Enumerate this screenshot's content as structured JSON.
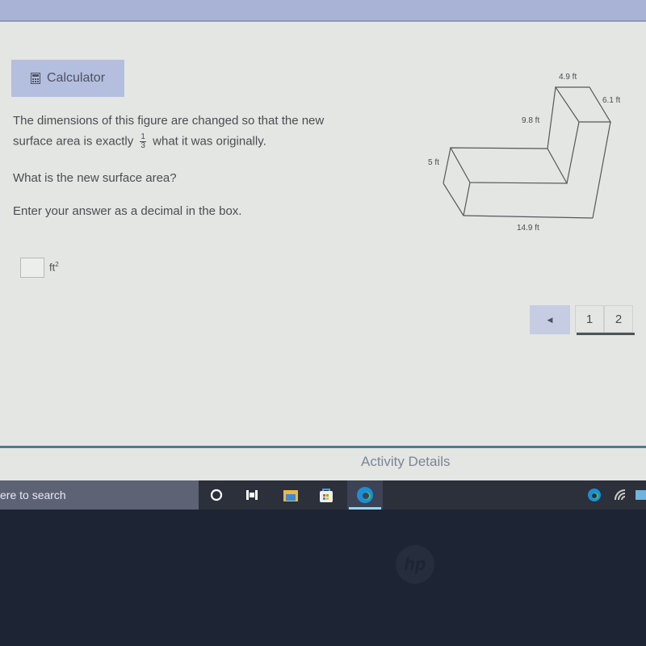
{
  "calculator": {
    "label": "Calculator",
    "icon": "calculator-icon"
  },
  "question": {
    "line1": "The dimensions of this figure are changed so that the new",
    "line2_pre": "surface area is exactly",
    "fraction": {
      "numerator": "1",
      "denominator": "3"
    },
    "line2_post": "what it was originally.",
    "prompt": "What is the new surface area?",
    "instruction": "Enter your answer as a decimal in the box."
  },
  "answer": {
    "value": "",
    "placeholder": "",
    "unit": "ft",
    "unit_exponent": "2"
  },
  "figure": {
    "labels": {
      "top_width": "4.9 ft",
      "top_depth": "6.1 ft",
      "vertical_height": "9.8 ft",
      "left_height": "5 ft",
      "bottom_length": "14.9 ft"
    }
  },
  "pagination": {
    "prev_icon": "◀",
    "pages": [
      "1",
      "2"
    ],
    "current": "1"
  },
  "footer": {
    "activity_details": "Activity Details"
  },
  "taskbar": {
    "search_text": "ere to search",
    "icons": [
      "cortana-icon",
      "task-view-icon",
      "file-explorer-icon",
      "store-icon",
      "edge-icon"
    ],
    "tray_icons": [
      "edge-tray-icon",
      "wifi-icon",
      "news-icon"
    ]
  },
  "colors": {
    "topbar": "#a9b3d6",
    "calc_button": "#b4bfdf",
    "divider": "#4d7a90",
    "taskbar": "#2b303b"
  }
}
